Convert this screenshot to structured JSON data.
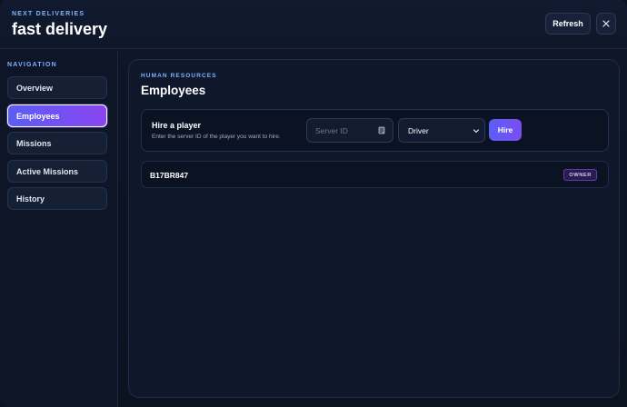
{
  "header": {
    "eyebrow": "NEXT DELIVERIES",
    "title": "fast delivery",
    "refresh_label": "Refresh",
    "close_icon": "close-icon"
  },
  "sidebar": {
    "section_label": "NAVIGATION",
    "items": [
      {
        "label": "Overview",
        "active": false
      },
      {
        "label": "Employees",
        "active": true
      },
      {
        "label": "Missions",
        "active": false
      },
      {
        "label": "Active Missions",
        "active": false
      },
      {
        "label": "History",
        "active": false
      }
    ]
  },
  "main": {
    "eyebrow": "HUMAN RESOURCES",
    "title": "Employees",
    "hire": {
      "title": "Hire a player",
      "description": "Enter the server ID of the player you want to hire.",
      "server_id_placeholder": "Server ID",
      "server_id_value": "",
      "role_selected": "Driver",
      "hire_label": "Hire"
    },
    "employees": [
      {
        "id": "B17BR847",
        "role_badge": "OWNER"
      }
    ]
  },
  "colors": {
    "accent_start": "#5b5ef5",
    "accent_end": "#8a45f0",
    "eyebrow": "#7fb3ff",
    "background": "#0b1220"
  }
}
